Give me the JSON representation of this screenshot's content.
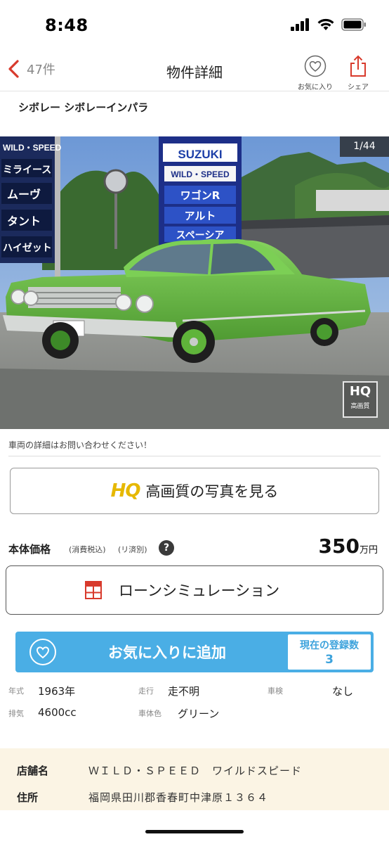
{
  "status_bar": {
    "time": "8:48"
  },
  "nav": {
    "back_count": "47件",
    "title": "物件詳細",
    "favorite_label": "お気に入り",
    "share_label": "シェア"
  },
  "car": {
    "title": "シボレー シボレーインパラ"
  },
  "photo": {
    "counter": "1/44",
    "hq_badge_big": "HQ",
    "hq_badge_small": "高画質",
    "signs_left": [
      "WILD・SPEED",
      "ミライース",
      "ムーヴ",
      "タント",
      "ハイゼット"
    ],
    "signs_center": [
      "SUZUKI",
      "WILD・SPEED",
      "ワゴンR",
      "アルト",
      "スペーシア"
    ]
  },
  "notice": "車両の詳細はお問い合わせください！",
  "hq_button": {
    "logo": "HQ",
    "label": "高画質の写真を見る"
  },
  "price": {
    "label": "本体価格",
    "tax": "(消費税込)",
    "repair": "(リ済別)",
    "help": "?",
    "value": "350",
    "unit": "万円"
  },
  "loan_button": {
    "label": "ローンシミュレーション"
  },
  "favorite_button": {
    "label": "お気に入りに追加",
    "count_label": "現在の登録数",
    "count": "3"
  },
  "specs": [
    {
      "label": "年式",
      "value": "1963年"
    },
    {
      "label": "走行",
      "value": "走不明"
    },
    {
      "label": "車検",
      "value": "なし"
    },
    {
      "label": "排気",
      "value": "4600cc"
    },
    {
      "label": "車体色",
      "value": "グリーン"
    }
  ],
  "shop": {
    "name_label": "店舗名",
    "name_value": "ＷＩＬＤ・ＳＰＥＥＤ　ワイルドスピード",
    "address_label": "住所",
    "address_value": "福岡県田川郡香春町中津原１３６４"
  },
  "colors": {
    "accent_red": "#d83a2c",
    "favorite_blue": "#4aaee5",
    "hq_gold": "#e6b800",
    "shop_bg": "#fbf4e4",
    "car_green": "#6cc04a"
  }
}
